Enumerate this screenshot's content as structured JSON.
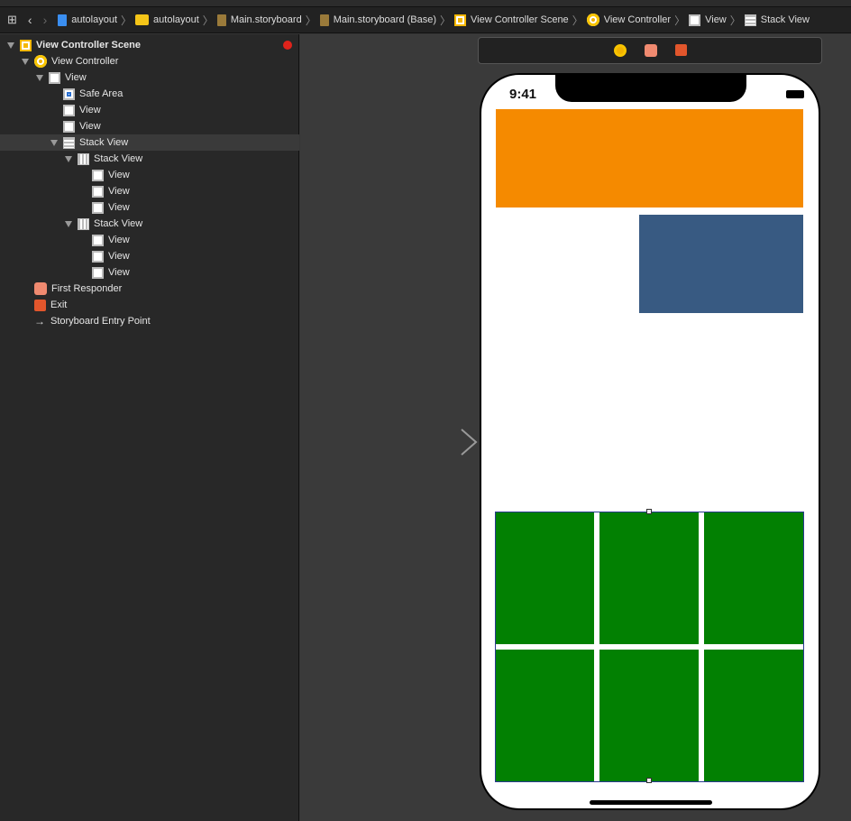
{
  "breadcrumb": [
    {
      "label": "autolayout",
      "icon": "project-file-icon"
    },
    {
      "label": "autolayout",
      "icon": "folder-icon"
    },
    {
      "label": "Main.storyboard",
      "icon": "storyboard-icon"
    },
    {
      "label": "Main.storyboard (Base)",
      "icon": "storyboard-icon"
    },
    {
      "label": "View Controller Scene",
      "icon": "scene-icon"
    },
    {
      "label": "View Controller",
      "icon": "view-controller-icon"
    },
    {
      "label": "View",
      "icon": "view-icon"
    },
    {
      "label": "Stack View",
      "icon": "stack-view-icon"
    }
  ],
  "outline": [
    {
      "label": "View Controller Scene",
      "icon": "scene-icon",
      "depth": 0,
      "expanded": true,
      "bold": true
    },
    {
      "label": "View Controller",
      "icon": "view-controller-icon",
      "depth": 1,
      "expanded": true
    },
    {
      "label": "View",
      "icon": "view-icon",
      "depth": 2,
      "expanded": true
    },
    {
      "label": "Safe Area",
      "icon": "safe-area-icon",
      "depth": 3
    },
    {
      "label": "View",
      "icon": "view-icon",
      "depth": 3
    },
    {
      "label": "View",
      "icon": "view-icon",
      "depth": 3
    },
    {
      "label": "Stack View",
      "icon": "stack-view-icon",
      "depth": 3,
      "expanded": true,
      "selected": true
    },
    {
      "label": "Stack View",
      "icon": "hstack-view-icon",
      "depth": 4,
      "expanded": true
    },
    {
      "label": "View",
      "icon": "view-icon",
      "depth": 5
    },
    {
      "label": "View",
      "icon": "view-icon",
      "depth": 5
    },
    {
      "label": "View",
      "icon": "view-icon",
      "depth": 5
    },
    {
      "label": "Stack View",
      "icon": "hstack-view-icon",
      "depth": 4,
      "expanded": true
    },
    {
      "label": "View",
      "icon": "view-icon",
      "depth": 5
    },
    {
      "label": "View",
      "icon": "view-icon",
      "depth": 5
    },
    {
      "label": "View",
      "icon": "view-icon",
      "depth": 5
    },
    {
      "label": "First Responder",
      "icon": "first-responder-icon",
      "depth": 1
    },
    {
      "label": "Exit",
      "icon": "exit-icon",
      "depth": 1
    },
    {
      "label": "Storyboard Entry Point",
      "icon": "arrow-right-icon",
      "depth": 1
    }
  ],
  "device": {
    "time": "9:41"
  },
  "colors": {
    "orange": "#f58a00",
    "blue": "#385a82",
    "green": "#028002",
    "error": "#e0231b"
  }
}
